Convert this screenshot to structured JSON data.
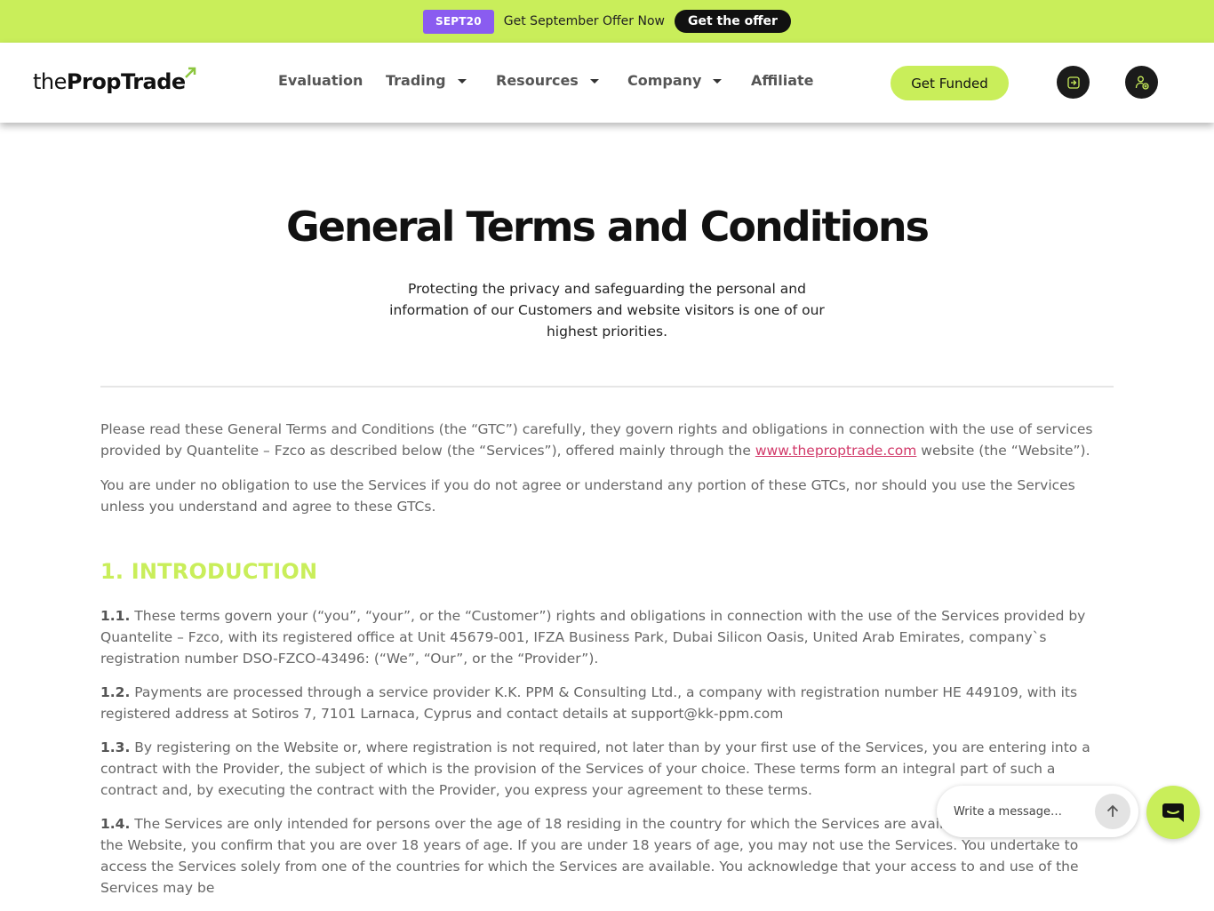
{
  "promo": {
    "code": "SEPT20",
    "text": "Get September Offer Now",
    "button": "Get the offer"
  },
  "header": {
    "logo": {
      "thin": "the",
      "bold": "PropTrade"
    },
    "nav": [
      {
        "label": "Evaluation",
        "dropdown": false
      },
      {
        "label": "Trading",
        "dropdown": true
      },
      {
        "label": "Resources",
        "dropdown": true
      },
      {
        "label": "Company",
        "dropdown": true
      },
      {
        "label": "Affiliate",
        "dropdown": false
      }
    ],
    "cta": "Get Funded",
    "icons": [
      "login-icon",
      "register-user-icon"
    ]
  },
  "hero": {
    "title": "General Terms and Conditions",
    "subtitle": "Protecting the privacy and safeguarding the personal and information of our Customers and website visitors is one of our highest priorities."
  },
  "intro": {
    "p1_before": "Please read these General Terms and Conditions (the “GTC”) carefully, they govern rights and obligations in connection with the use of services provided by Quantelite – Fzco as described below (the “Services”), offered mainly through the ",
    "p1_link": "www.theproptrade.com",
    "p1_after": " website (the “Website”).",
    "p2": "You are under no obligation to use the Services if you do not agree or understand any portion of these GTCs, nor should you use the Services unless you understand and agree to these GTCs."
  },
  "section1": {
    "title": "1. INTRODUCTION",
    "clauses": [
      {
        "num": "1.1.",
        "text": " These terms govern your (“you”, “your”, or the “Customer”) rights and obligations in connection with the use of the Services provided by Quantelite – Fzco, with its registered office at Unit 45679-001, IFZA Business Park, Dubai Silicon Oasis, United Arab Emirates, company`s registration number DSO-FZCO-43496: (“We”, “Our”, or the “Provider”)."
      },
      {
        "num": "1.2.",
        "text": " Payments are processed through a service provider K.K. PPM & Consulting Ltd., a company with registration number HE 449109, with its registered address at Sotiros 7, 7101 Larnaca, Cyprus and contact details at support@kk-ppm.com"
      },
      {
        "num": "1.3.",
        "text": " By registering on the Website or, where registration is not required, not later than by your first use of the Services, you are entering into a contract with the Provider, the subject of which is the provision of the Services of your choice. These terms form an integral part of such a contract and, by executing the contract with the Provider, you express your agreement to these terms."
      },
      {
        "num": "1.4.",
        "text": " The Services are only intended for persons over the age of 18 residing in the country for which the Services are available. By registering on the Website, you confirm that you are over 18 years of age. If you are under 18 years of age, you may not use the Services. You undertake to access the Services solely from one of the countries for which the Services are available. You acknowledge that your access to and use of the Services may be"
      }
    ]
  },
  "chat": {
    "placeholder": "Write a message…"
  },
  "colors": {
    "accent": "#c9ee5a",
    "promo_code_bg": "#8a5cf0",
    "link": "#d23a6a",
    "dark": "#1b1b1b"
  }
}
